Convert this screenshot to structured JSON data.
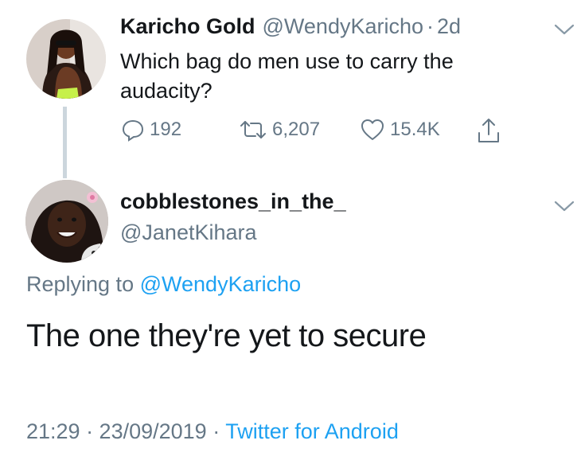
{
  "parent_tweet": {
    "display_name": "Karicho Gold",
    "handle": "@WendyKaricho",
    "separator": "·",
    "time_ago": "2d",
    "text": "Which bag do men use to carry the audacity?",
    "stats": {
      "replies": "192",
      "retweets": "6,207",
      "likes": "15.4K"
    },
    "menu_icon": "chevron-down-icon"
  },
  "reply_tweet": {
    "display_name": "cobblestones_in_the_",
    "handle": "@JanetKihara",
    "replying_prefix": "Replying to",
    "replying_to": "@WendyKaricho",
    "text": "The one they're yet to secure",
    "timestamp": "21:29 · 23/09/2019",
    "separator": "·",
    "source": "Twitter for Android",
    "menu_icon": "chevron-down-icon"
  },
  "colors": {
    "text": "#14171a",
    "muted": "#657786",
    "link": "#1da1f2",
    "thread_line": "#ccd6dd",
    "chevron": "#8899a6"
  },
  "icons": [
    "reply-icon",
    "retweet-icon",
    "like-icon",
    "share-icon",
    "chevron-down-icon"
  ]
}
